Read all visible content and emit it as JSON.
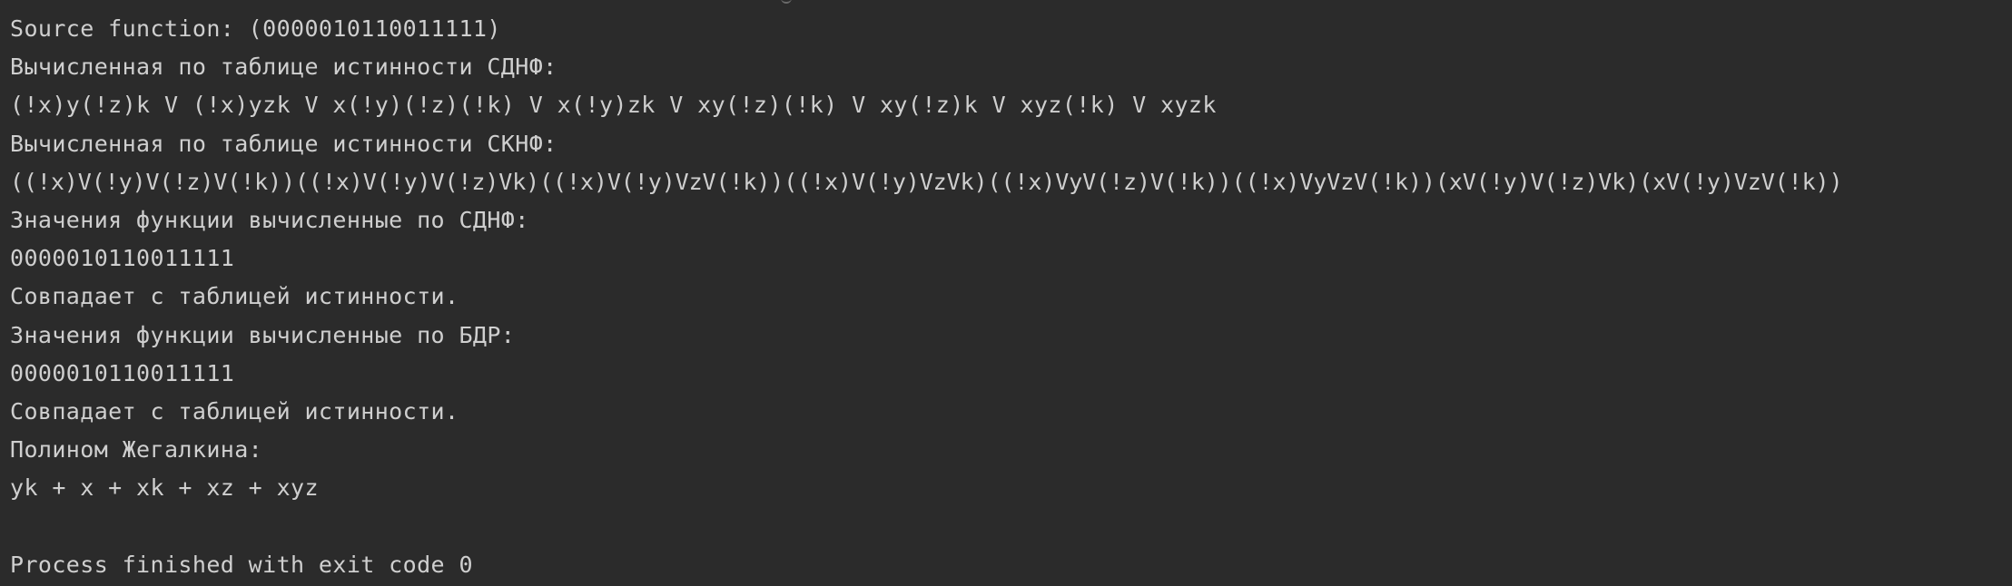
{
  "console": {
    "lines": [
      {
        "text": "Source function: (0000010110011111)"
      },
      {
        "text": "Вычисленная по таблице истинности СДНФ:"
      },
      {
        "text": "(!x)y(!z)k V (!x)yzk V x(!y)(!z)(!k) V x(!y)zk V xy(!z)(!k) V xy(!z)k V xyz(!k) V xyzk"
      },
      {
        "text": "Вычисленная по таблице истинности СКНФ:"
      },
      {
        "text": "((!x)V(!y)V(!z)V(!k))((!x)V(!y)V(!z)Vk)((!x)V(!y)VzV(!k))((!x)V(!y)VzVk)((!x)VyV(!z)V(!k))((!x)VyVzV(!k))(xV(!y)V(!z)Vk)(xV(!y)VzV(!k))"
      },
      {
        "text": "Значения функции вычисленные по СДНФ:"
      },
      {
        "text": "0000010110011111"
      },
      {
        "text": "Совпадает с таблицей истинности."
      },
      {
        "text": "Значения функции вычисленные по БДР:"
      },
      {
        "text": "0000010110011111"
      },
      {
        "text": "Совпадает с таблицей истинности."
      },
      {
        "text": "Полином Жегалкина:"
      },
      {
        "text": "yk + x + xk + xz + xyz"
      },
      {
        "text": ""
      },
      {
        "text": "Process finished with exit code 0"
      }
    ]
  },
  "colors": {
    "background": "#2b2b2b",
    "text": "#cfcfcf"
  }
}
